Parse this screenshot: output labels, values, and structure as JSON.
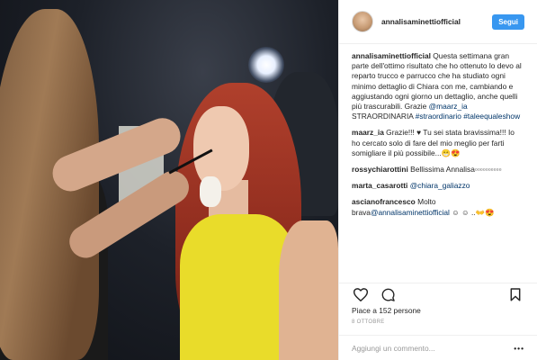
{
  "header": {
    "username": "annalisaminettiofficial",
    "follow_label": "Segui"
  },
  "comments": [
    {
      "user": "annalisaminettiofficial",
      "text": " Questa settimana gran parte dell'ottimo risultato che ho ottenuto lo devo al reparto trucco e parrucco che ha studiato ogni minimo dettaglio di Chiara con me, cambiando e aggiustando ogni giorno un dettaglio, anche quelli più trascurabili. Grazie ",
      "mention": "@maarz_ia",
      "text2": " STRAORDINARIA ",
      "tags": "#straordinario #taleequaleshow"
    },
    {
      "user": "maarz_ia",
      "text": " Grazie!!! ♥ Tu sei stata bravissima!!! Io ho cercato solo di fare del mio meglio per farti somigliare il più possibile...😁😍"
    },
    {
      "user": "rossychiarottini",
      "text": " Bellissima Annalisa▫▫▫▫▫▫▫▫▫▫"
    },
    {
      "user": "marta_casarotti",
      "text": " ",
      "mention": "@chiara_galiazzo"
    },
    {
      "user": "ascianofrancesco",
      "text": " Molto brava",
      "mention": "@annalisaminettiofficial",
      "text2": " ☺ ☺ ..👐😍"
    }
  ],
  "stats": {
    "likes": "Piace a 152 persone",
    "date": "8 OTTOBRE"
  },
  "add_comment": {
    "placeholder": "Aggiungi un commento...",
    "more": "•••"
  },
  "icons": {
    "like": "heart-icon",
    "comment": "comment-icon",
    "save": "bookmark-icon"
  },
  "colors": {
    "follow_button": "#3897f0",
    "link": "#003569"
  }
}
